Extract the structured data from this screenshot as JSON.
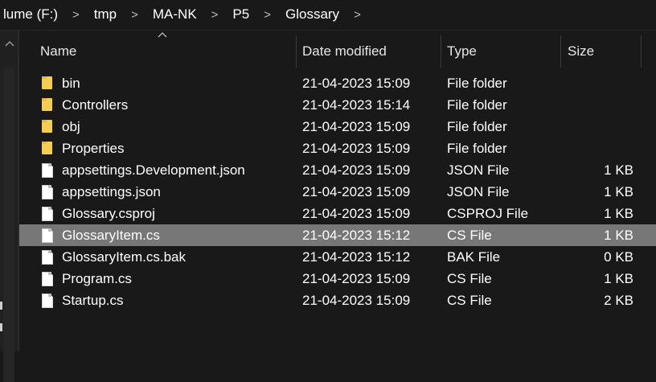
{
  "breadcrumb": {
    "items": [
      "lume (F:)",
      "tmp",
      "MA-NK",
      "P5",
      "Glossary"
    ],
    "separator": ">"
  },
  "columns": {
    "name": "Name",
    "date": "Date modified",
    "type": "Type",
    "size": "Size",
    "sort_indicator": "^"
  },
  "files": [
    {
      "name": "bin",
      "date": "21-04-2023 15:09",
      "type": "File folder",
      "size": "",
      "icon": "folder-icon"
    },
    {
      "name": "Controllers",
      "date": "21-04-2023 15:14",
      "type": "File folder",
      "size": "",
      "icon": "folder-icon"
    },
    {
      "name": "obj",
      "date": "21-04-2023 15:09",
      "type": "File folder",
      "size": "",
      "icon": "folder-icon"
    },
    {
      "name": "Properties",
      "date": "21-04-2023 15:09",
      "type": "File folder",
      "size": "",
      "icon": "folder-icon"
    },
    {
      "name": "appsettings.Development.json",
      "date": "21-04-2023 15:09",
      "type": "JSON File",
      "size": "1 KB",
      "icon": "file-icon"
    },
    {
      "name": "appsettings.json",
      "date": "21-04-2023 15:09",
      "type": "JSON File",
      "size": "1 KB",
      "icon": "file-icon"
    },
    {
      "name": "Glossary.csproj",
      "date": "21-04-2023 15:09",
      "type": "CSPROJ File",
      "size": "1 KB",
      "icon": "file-icon"
    },
    {
      "name": "GlossaryItem.cs",
      "date": "21-04-2023 15:12",
      "type": "CS File",
      "size": "1 KB",
      "icon": "file-icon",
      "selected": true
    },
    {
      "name": "GlossaryItem.cs.bak",
      "date": "21-04-2023 15:12",
      "type": "BAK File",
      "size": "0 KB",
      "icon": "file-icon"
    },
    {
      "name": "Program.cs",
      "date": "21-04-2023 15:09",
      "type": "CS File",
      "size": "1 KB",
      "icon": "file-icon"
    },
    {
      "name": "Startup.cs",
      "date": "21-04-2023 15:09",
      "type": "CS File",
      "size": "2 KB",
      "icon": "file-icon"
    }
  ],
  "colors": {
    "background": "#191919",
    "selected_row": "#777777",
    "folder": "#f4cd55",
    "text": "#ffffff"
  }
}
